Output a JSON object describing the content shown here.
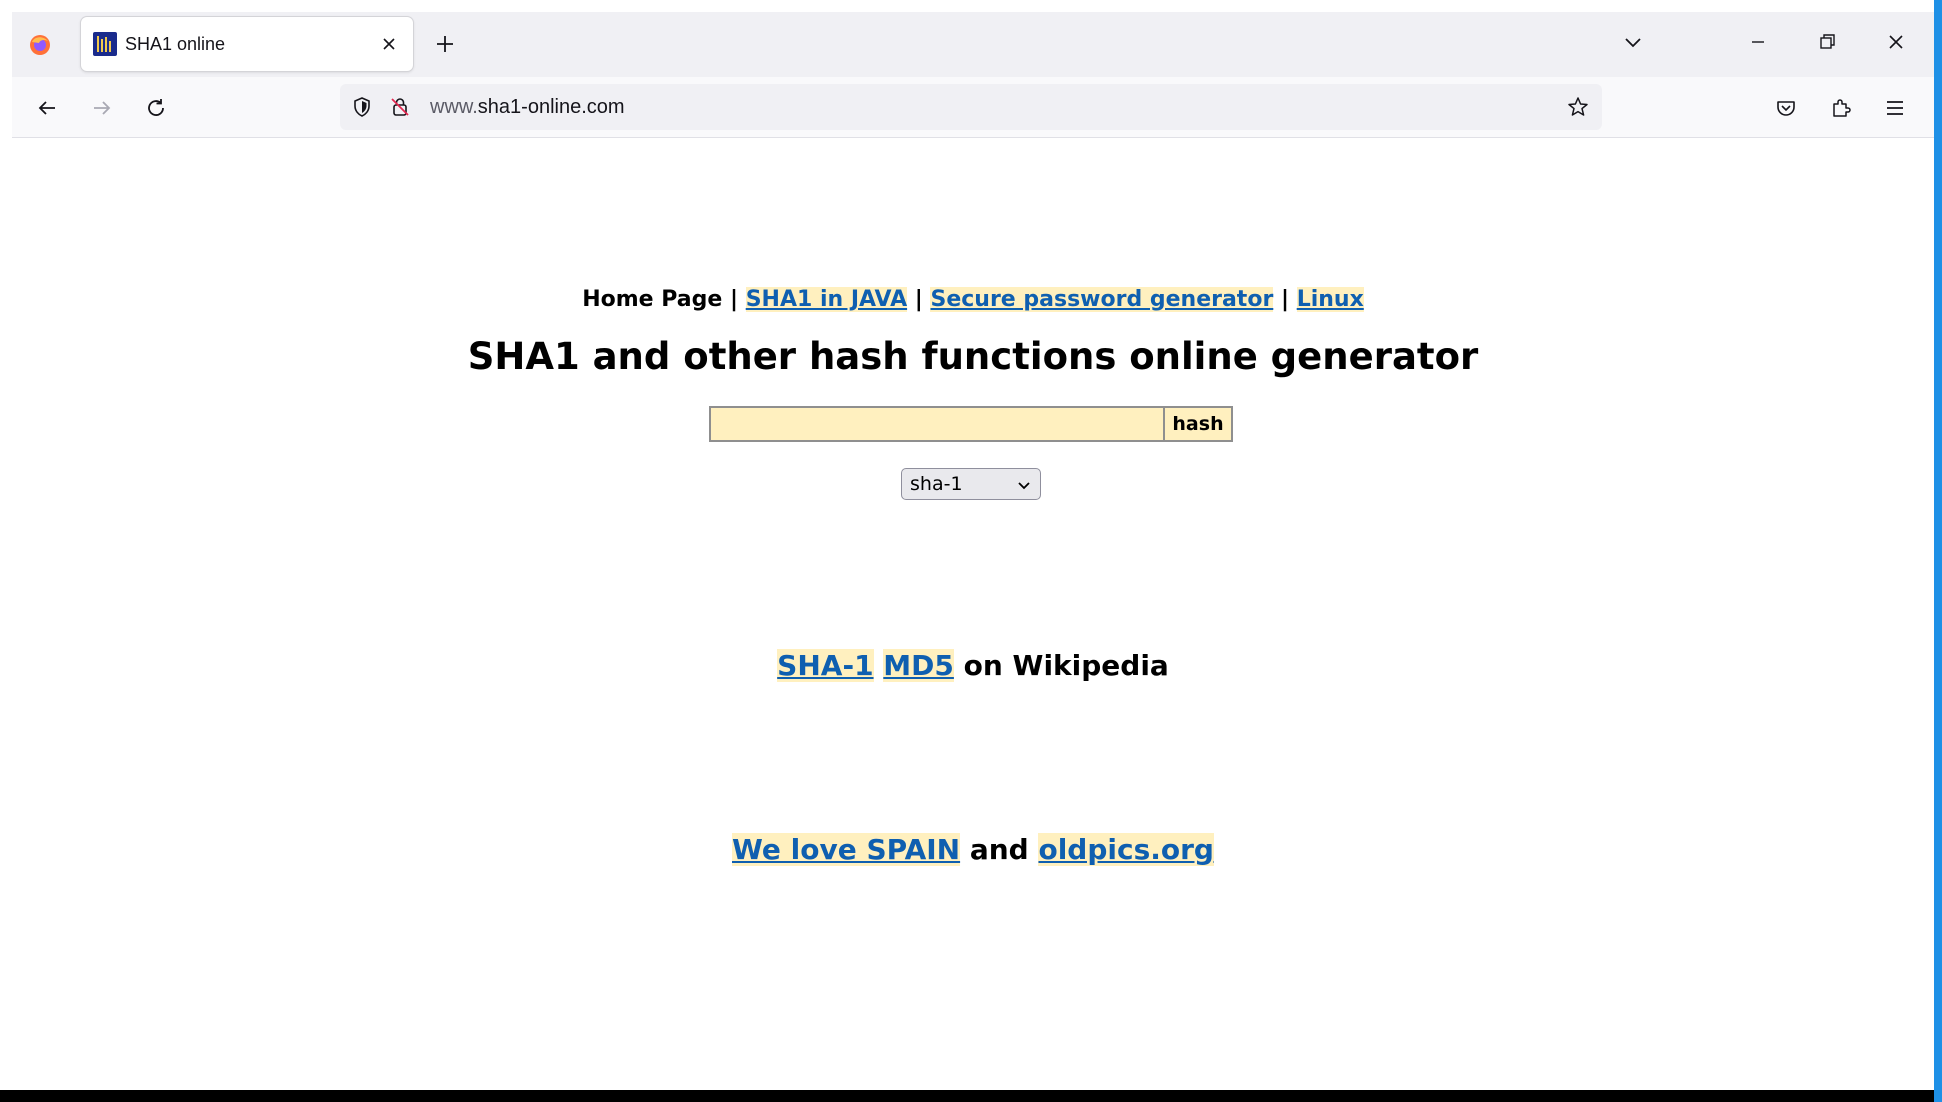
{
  "browser": {
    "tab": {
      "title": "SHA1 online"
    },
    "url": {
      "prefix": "www.",
      "domain": "sha1-online.com"
    }
  },
  "nav": {
    "home": "Home Page",
    "separator": "|",
    "java": "SHA1 in JAVA",
    "password": "Secure password generator",
    "linux": "Linux"
  },
  "heading": "SHA1 and other hash functions online generator",
  "form": {
    "input_value": "",
    "button_label": "hash",
    "algorithm": "sha-1"
  },
  "wiki": {
    "sha1": "SHA-1",
    "md5": "MD5",
    "suffix": "on Wikipedia"
  },
  "footer": {
    "spain": "We love SPAIN",
    "and": "and",
    "oldpics": "oldpics.org"
  },
  "colors": {
    "link": "#0f5fb0",
    "highlight": "#fff0bf",
    "favicon": "#1a2b8c",
    "window_edge": "#1e90e6"
  }
}
